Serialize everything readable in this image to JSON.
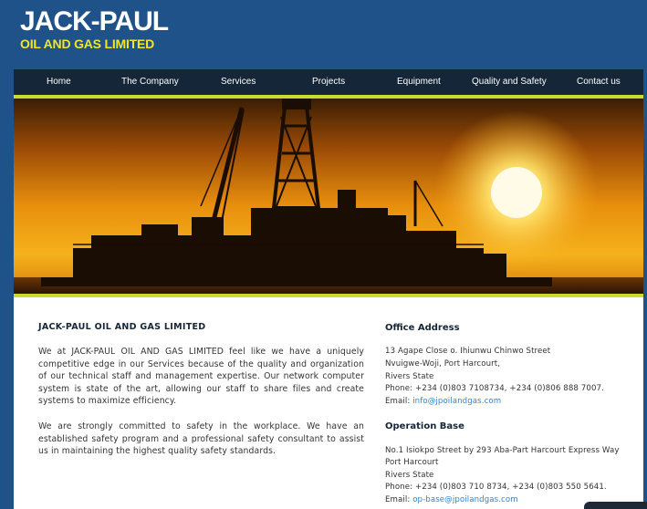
{
  "brand": {
    "name": "JACK-PAUL",
    "tagline": "OIL AND GAS LIMITED"
  },
  "nav": {
    "items": [
      {
        "label": "Home"
      },
      {
        "label": "The Company"
      },
      {
        "label": "Services"
      },
      {
        "label": "Projects"
      },
      {
        "label": "Equipment"
      },
      {
        "label": "Quality and Safety"
      },
      {
        "label": "Contact us"
      }
    ]
  },
  "colors": {
    "page_bg": "#1f5288",
    "nav_bg": "#142638",
    "accent_bar": "#c9db2c",
    "logo_sub": "#f4e528",
    "link": "#2e86d6"
  },
  "about": {
    "title": "JACK-PAUL OIL AND GAS LIMITED",
    "paragraphs": [
      "We at JACK-PAUL OIL AND GAS LIMITED feel like we have a uniquely competitive edge in our Services because of the quality and organization of our technical staff and management expertise. Our network computer system is state of the art, allowing our staff to share files and create systems to maximize efficiency.",
      "We are strongly committed to safety in the workplace. We have an established safety program and a professional safety consultant to assist us in maintaining the highest quality safety standards."
    ]
  },
  "office": {
    "title": "Office Address",
    "lines": [
      "13 Agape Close o. Ihiunwu Chinwo Street",
      "Nvuigwe-Woji, Port Harcourt,",
      "Rivers State",
      "Phone: +234 (0)803 7108734, +234 (0)806 888 7007."
    ],
    "email_label": "Email:",
    "email": "info@jpoilandgas.com"
  },
  "base": {
    "title": "Operation Base",
    "lines": [
      "No.1 Isiokpo Street by 293 Aba-Part Harcourt Express Way",
      "Port Harcourt",
      "Rivers State",
      "Phone: +234 (0)803 710 8734, +234 (0)803 550 5641."
    ],
    "email_label": "Email:",
    "email": "op-base@jpoilandgas.com"
  }
}
